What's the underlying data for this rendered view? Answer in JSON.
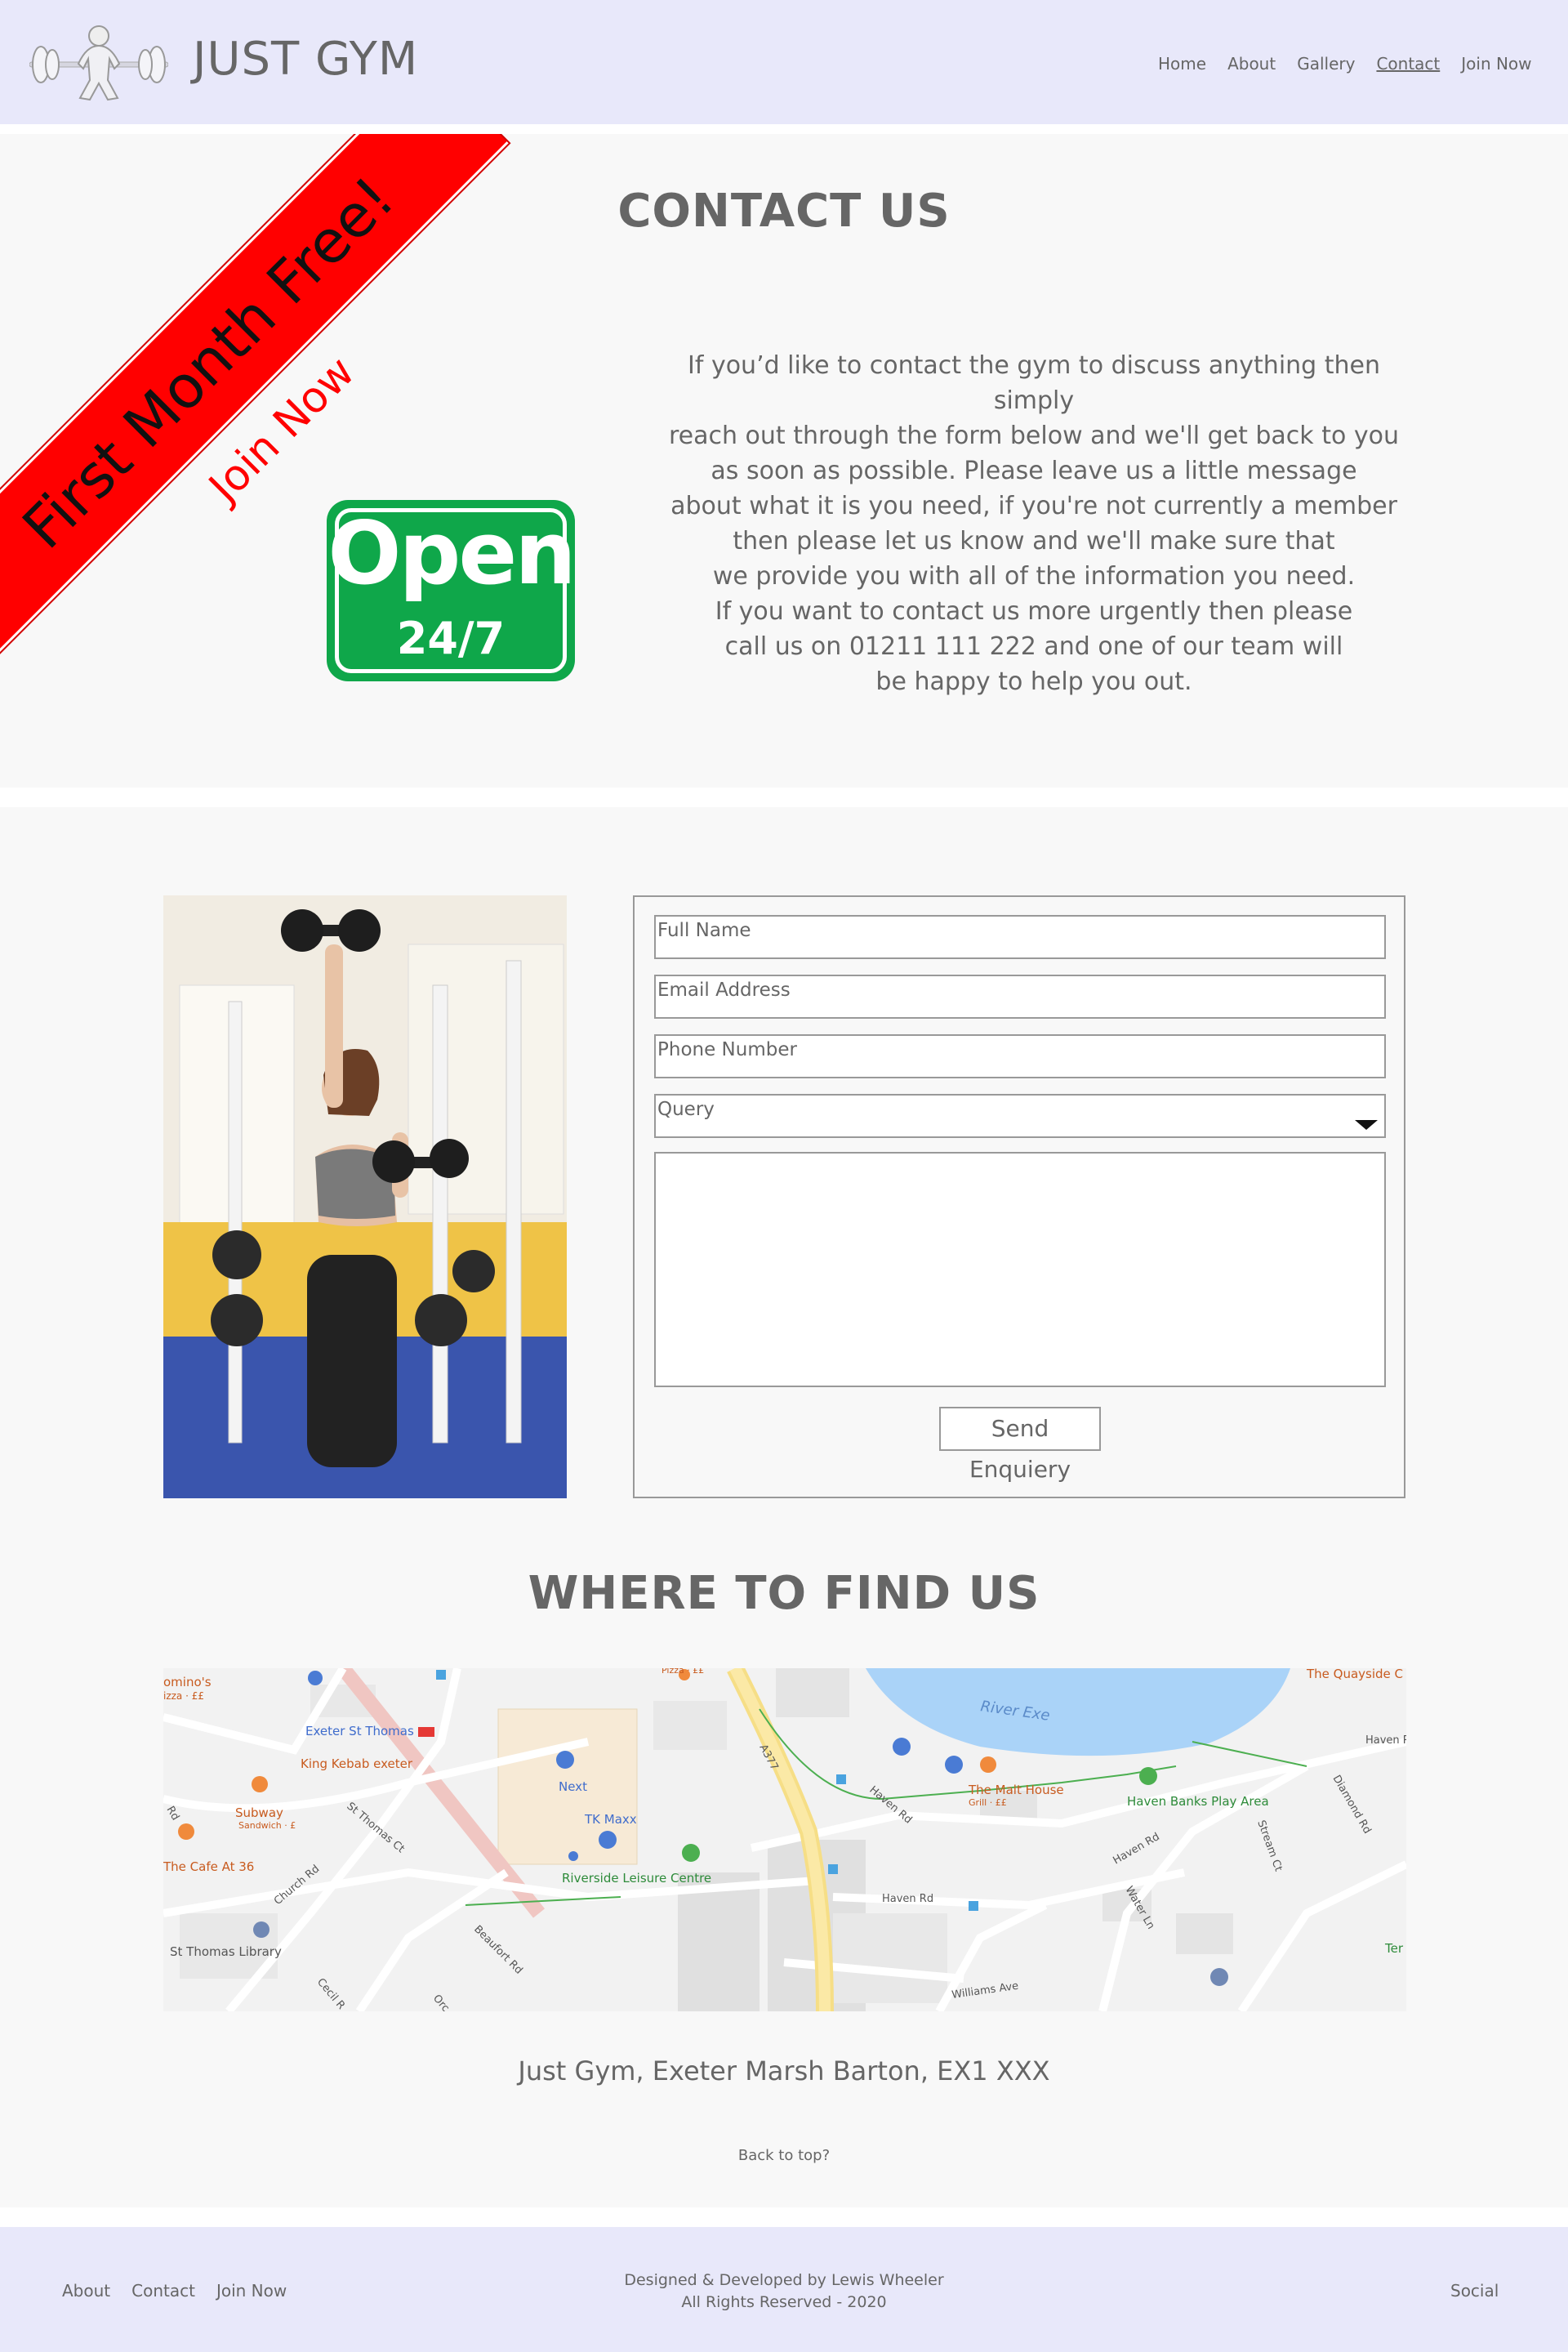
{
  "header": {
    "brand": "JUST GYM",
    "nav": [
      {
        "label": "Home"
      },
      {
        "label": "About"
      },
      {
        "label": "Gallery"
      },
      {
        "label": "Contact",
        "active": true
      },
      {
        "label": "Join Now"
      }
    ]
  },
  "promo": {
    "ribbon": "First Month Free!",
    "join": "Join Now",
    "sign_top": "Open",
    "sign_bottom": "24/7"
  },
  "contact": {
    "heading": "CONTACT US",
    "intro_lines": [
      "If you’d like to contact the gym to discuss anything then simply",
      "reach out through the form below and we'll get back to you",
      "as soon as possible. Please leave us a little message",
      "about what it is you need, if you're not currently a member",
      "then please let us know and we'll make sure that",
      "we provide you with all of the information you need.",
      "If you want to contact us more urgently then please",
      "call us on 01211 111 222 and one of our team will",
      "be happy to help you out."
    ]
  },
  "form": {
    "full_name_placeholder": "Full Name",
    "email_placeholder": "Email Address",
    "phone_placeholder": "Phone Number",
    "query_selected": "Query",
    "message_value": "",
    "submit_label": "Send Enquiery"
  },
  "find": {
    "heading": "WHERE TO FIND US",
    "map_labels": {
      "dominos": "omino's",
      "dominos_sub": "izza · ££",
      "exeter_st_thomas": "Exeter St Thomas",
      "king_kebab": "King Kebab exeter",
      "subway": "Subway",
      "subway_sub": "Sandwich · £",
      "cafe": "The Cafe At 36",
      "next": "Next",
      "tk_maxx": "TK Maxx",
      "riverside": "Riverside Leisure Centre",
      "st_thomas_library": "St Thomas Library",
      "river_exe": "River Exe",
      "malt_house": "The Malt House",
      "malt_house_sub": "Grill · ££",
      "haven_banks": "Haven Banks Play Area",
      "quayside": "The Quayside C",
      "a377": "A377",
      "haven_rd": "Haven Rd",
      "haven_rd2": "Haven Rd",
      "haven_rd3": "Haven Rd",
      "haven_r": "Haven R",
      "church_rd": "Church Rd",
      "beaufort_rd": "Beaufort Rd",
      "st_thomas_ct": "St Thomas Ct",
      "cecil_rd": "Cecil R",
      "orc": "Orc",
      "diamond_rd": "Diamond Rd",
      "stream_ct": "Stream Ct",
      "water_ln": "Water Ln",
      "williams_ave": "Williams Ave",
      "ter": "Ter",
      "pizza": "Pizza · ££",
      "rd": "Rd"
    },
    "address": "Just Gym, Exeter Marsh Barton, EX1 XXX",
    "back_to_top": "Back to top?"
  },
  "footer": {
    "nav": [
      {
        "label": "About"
      },
      {
        "label": "Contact"
      },
      {
        "label": "Join Now"
      }
    ],
    "credit_line1": "Designed & Developed by Lewis Wheeler",
    "credit_line2": "All Rights Reserved - 2020",
    "social": "Social"
  },
  "colors": {
    "header_bg": "#e8e8fa",
    "section_bg": "#f8f8f8",
    "ribbon_red": "#ff0000",
    "sign_green": "#0fa74a",
    "text_grey": "#666666"
  },
  "icons": [
    "weightlifter-logo-icon",
    "dropdown-caret-icon",
    "map-pin-icon",
    "train-station-icon",
    "food-icon",
    "shopping-icon",
    "park-icon"
  ]
}
